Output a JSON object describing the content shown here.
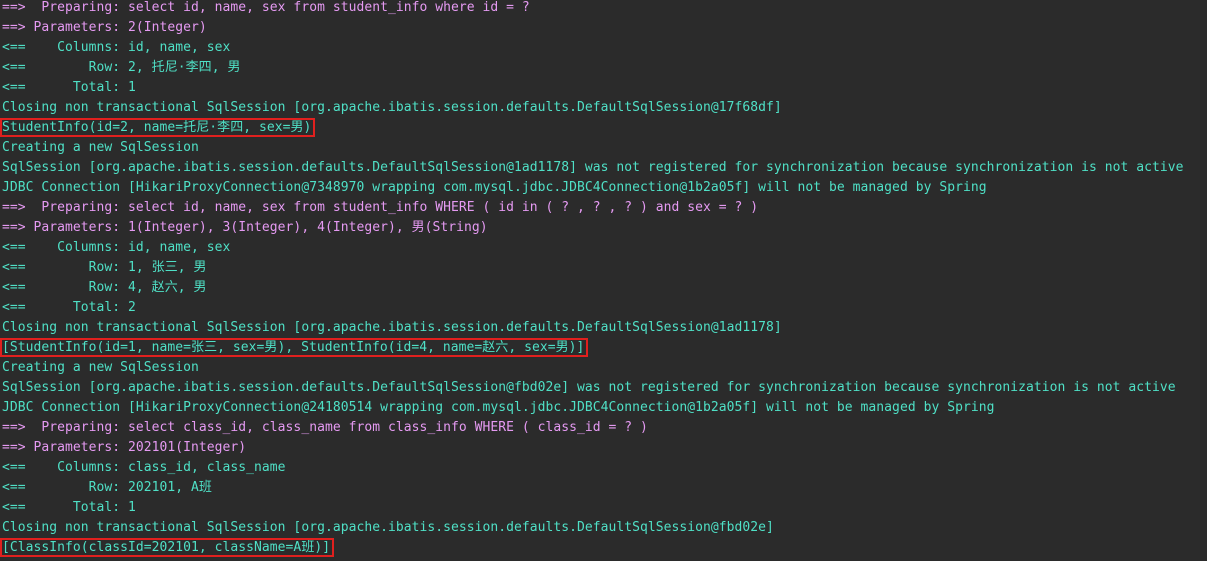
{
  "colors": {
    "background": "#2b2b2b",
    "info": "#4fe0c6",
    "sql": "#e59af2",
    "highlight_box": "#e0201e"
  },
  "lines": [
    {
      "text": "==>  Preparing: select id, name, sex from student_info where id = ?",
      "style": "pink"
    },
    {
      "text": "==> Parameters: 2(Integer)",
      "style": "pink"
    },
    {
      "text": "<==    Columns: id, name, sex",
      "style": ""
    },
    {
      "text": "<==        Row: 2, 托尼·李四, 男",
      "style": ""
    },
    {
      "text": "<==      Total: 1",
      "style": ""
    },
    {
      "text": "Closing non transactional SqlSession [org.apache.ibatis.session.defaults.DefaultSqlSession@17f68df]",
      "style": ""
    },
    {
      "text": "StudentInfo(id=2, name=托尼·李四, sex=男)",
      "style": "boxed"
    },
    {
      "text": "Creating a new SqlSession",
      "style": ""
    },
    {
      "text": "SqlSession [org.apache.ibatis.session.defaults.DefaultSqlSession@1ad1178] was not registered for synchronization because synchronization is not active",
      "style": ""
    },
    {
      "text": "JDBC Connection [HikariProxyConnection@7348970 wrapping com.mysql.jdbc.JDBC4Connection@1b2a05f] will not be managed by Spring",
      "style": ""
    },
    {
      "text": "==>  Preparing: select id, name, sex from student_info WHERE ( id in ( ? , ? , ? ) and sex = ? )",
      "style": "pink"
    },
    {
      "text": "==> Parameters: 1(Integer), 3(Integer), 4(Integer), 男(String)",
      "style": "pink"
    },
    {
      "text": "<==    Columns: id, name, sex",
      "style": ""
    },
    {
      "text": "<==        Row: 1, 张三, 男",
      "style": ""
    },
    {
      "text": "<==        Row: 4, 赵六, 男",
      "style": ""
    },
    {
      "text": "<==      Total: 2",
      "style": ""
    },
    {
      "text": "Closing non transactional SqlSession [org.apache.ibatis.session.defaults.DefaultSqlSession@1ad1178]",
      "style": ""
    },
    {
      "text": "[StudentInfo(id=1, name=张三, sex=男), StudentInfo(id=4, name=赵六, sex=男)]",
      "style": "boxed"
    },
    {
      "text": "Creating a new SqlSession",
      "style": ""
    },
    {
      "text": "SqlSession [org.apache.ibatis.session.defaults.DefaultSqlSession@fbd02e] was not registered for synchronization because synchronization is not active",
      "style": ""
    },
    {
      "text": "JDBC Connection [HikariProxyConnection@24180514 wrapping com.mysql.jdbc.JDBC4Connection@1b2a05f] will not be managed by Spring",
      "style": ""
    },
    {
      "text": "==>  Preparing: select class_id, class_name from class_info WHERE ( class_id = ? )",
      "style": "pink"
    },
    {
      "text": "==> Parameters: 202101(Integer)",
      "style": "pink"
    },
    {
      "text": "<==    Columns: class_id, class_name",
      "style": ""
    },
    {
      "text": "<==        Row: 202101, A班",
      "style": ""
    },
    {
      "text": "<==      Total: 1",
      "style": ""
    },
    {
      "text": "Closing non transactional SqlSession [org.apache.ibatis.session.defaults.DefaultSqlSession@fbd02e]",
      "style": ""
    },
    {
      "text": "[ClassInfo(classId=202101, className=A班)]",
      "style": "boxed"
    }
  ]
}
